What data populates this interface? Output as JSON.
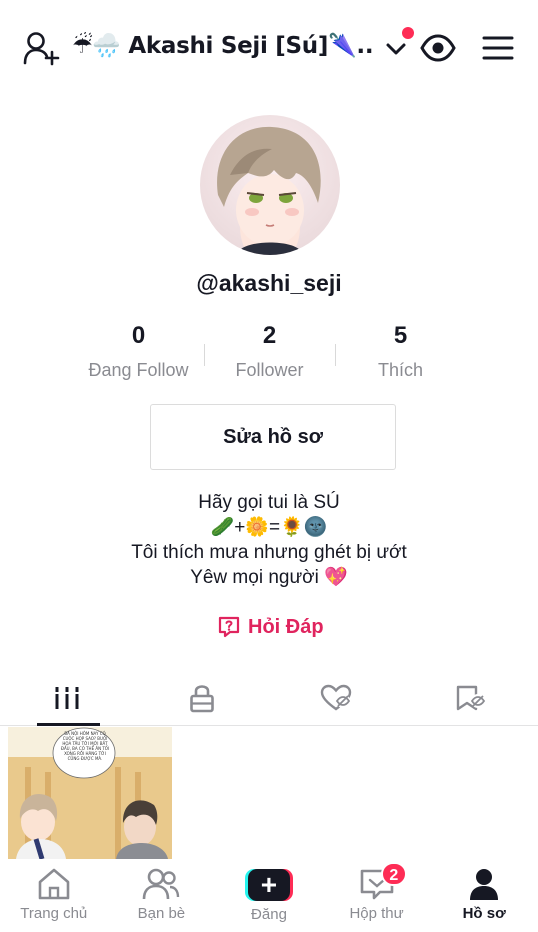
{
  "header": {
    "title": "☔🌧️ Akashi Seji [Sú]🌂...",
    "icons": [
      "add-user-icon",
      "chevron-down-icon",
      "eye-icon",
      "menu-icon"
    ]
  },
  "profile": {
    "username": "@akashi_seji",
    "stats": [
      {
        "value": "0",
        "label": "Đang Follow"
      },
      {
        "value": "2",
        "label": "Follower"
      },
      {
        "value": "5",
        "label": "Thích"
      }
    ],
    "edit_label": "Sửa hồ sơ",
    "bio": [
      "Hãy gọi tui là SÚ",
      "🥒+🌼=🌻🌚",
      "Tôi thích mưa nhưng ghét bị ướt",
      "Yêw mọi người 💖"
    ],
    "qa_label": "Hỏi Đáp"
  },
  "tabs": [
    "videos-grid-icon",
    "lock-icon",
    "liked-hidden-icon",
    "favorites-hidden-icon"
  ],
  "video": {
    "caption": "BÁ NỘI HÔM NAY CÓ CUỘC HỌP SAO? BUỔI HỌA TÂU TỚI MỚI BẮT ĐẦU, BA CÓ THỂ ĂN TỐI XONG RỒI HÃNG TỚI CŨNG ĐƯỢC MÀ."
  },
  "bottom_nav": [
    {
      "label": "Trang chủ"
    },
    {
      "label": "Bạn bè"
    },
    {
      "label": "Đăng"
    },
    {
      "label": "Hộp thư",
      "badge": "2"
    },
    {
      "label": "Hồ sơ"
    }
  ],
  "colors": {
    "accent": "#fe2c55",
    "cyan": "#25f4ee",
    "text": "#161823",
    "muted": "#8a8b91"
  }
}
